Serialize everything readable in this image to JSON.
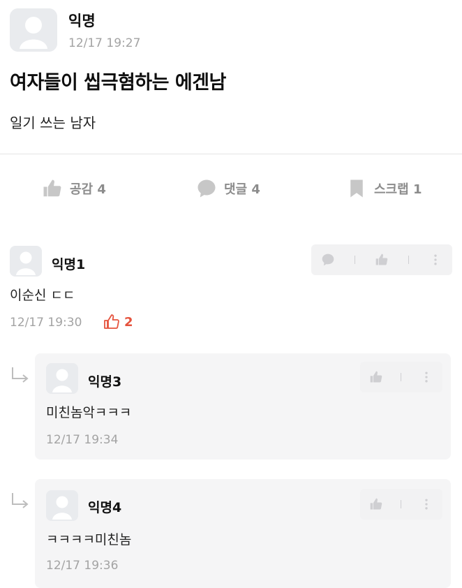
{
  "post": {
    "author": "익명",
    "time": "12/17 19:27",
    "title": "여자들이 씹극혐하는 에겐남",
    "body": "일기 쓰는 남자"
  },
  "actions": {
    "like_label": "공감 4",
    "comment_label": "댓글 4",
    "scrap_label": "스크랩 1"
  },
  "comments": [
    {
      "author": "익명1",
      "text": "이순신 ㄷㄷ",
      "time": "12/17 19:30",
      "likes": "2"
    }
  ],
  "replies": [
    {
      "author": "익명3",
      "text": "미친놈악ㅋㅋㅋ",
      "time": "12/17 19:34"
    },
    {
      "author": "익명4",
      "text": "ㅋㅋㅋㅋ미친놈",
      "time": "12/17 19:36"
    }
  ],
  "colors": {
    "muted": "#a3a3a3",
    "icon": "#c7c7c7",
    "like_accent": "#e5533d",
    "reply_bg": "#f5f5f6"
  },
  "icons": [
    "avatar-icon",
    "thumbs-up-icon",
    "speech-bubble-icon",
    "bookmark-icon",
    "more-icon",
    "reply-arrow-icon"
  ]
}
